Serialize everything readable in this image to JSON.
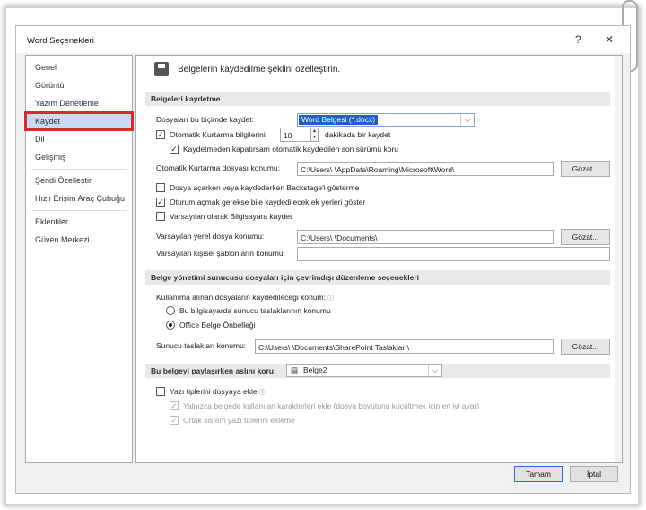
{
  "dialog": {
    "title": "Word Seçenekleri",
    "help_label": "?",
    "close_label": "✕"
  },
  "sidebar": {
    "items": [
      {
        "label": "Genel"
      },
      {
        "label": "Görüntü"
      },
      {
        "label": "Yazım Denetleme"
      },
      {
        "label": "Kaydet",
        "selected": true
      },
      {
        "label": "Dil"
      },
      {
        "label": "Gelişmiş"
      },
      {
        "label": "Şeridi Özelleştir"
      },
      {
        "label": "Hızlı Erişim Araç Çubuğu"
      },
      {
        "label": "Eklentiler"
      },
      {
        "label": "Güven Merkezi"
      }
    ]
  },
  "header": {
    "icon": "floppy-disk-icon",
    "text": "Belgelerin kaydedilme şeklini özelleştirin."
  },
  "save_docs": {
    "section_title": "Belgeleri kaydetme",
    "format_label": "Dosyaları bu biçimde kaydet:",
    "format_value": "Word Belgesi (*.docx)",
    "autorecover_label": "Otomatik Kurtarma bilgilerini",
    "autorecover_value": "10",
    "autorecover_suffix": "dakikada bir kaydet",
    "keep_last_label": "Kaydetmeden kapatırsam otomatik kaydedilen son sürümü koru",
    "autorecover_loc_label": "Otomatik Kurtarma dosyası konumu:",
    "autorecover_loc_value": "C:\\Users\\ \\AppData\\Roaming\\Microsoft\\Word\\",
    "browse_label": "Gözat...",
    "no_backstage_label": "Dosya açarken veya kaydederken Backstage'i gösterme",
    "show_more_label": "Oturum açmak gerekse bile kaydedilecek ek yerleri göster",
    "default_computer_label": "Varsayılan olarak Bilgisayara kaydet",
    "default_local_label": "Varsayılan yerel dosya konumu:",
    "default_local_value": "C:\\Users\\ \\Documents\\",
    "templates_label": "Varsayılan kişisel şablonların konumu:",
    "templates_value": ""
  },
  "offline": {
    "section_title": "Belge yönetimi sunucusu dosyaları için çevrimdışı düzenleme seçenekleri",
    "save_location_label": "Kullanıma alınan dosyaların kaydedileceği konum:",
    "radio1_label": "Bu bilgisayarda sunucu taslaklarının konumu",
    "radio2_label": "Office Belge Önbelleği",
    "drafts_label": "Sunucu taslakları konumu:",
    "drafts_value": "C:\\Users\\ \\Documents\\SharePoint Taslakları\\",
    "browse_label": "Gözat..."
  },
  "fidelity": {
    "section_title": "Bu belgeyi paylaşırken aslını koru:",
    "doc_value": "Belge2",
    "embed_fonts_label": "Yazı tiplerini dosyaya ekle",
    "embed_chars_label": "Yalnızca belgede kullanılan karakterleri ekle (dosya boyutunu küçültmek için en iyi ayar)",
    "no_common_label": "Ortak sistem yazı tiplerini ekleme"
  },
  "footer": {
    "ok_label": "Tamam",
    "cancel_label": "İptal"
  },
  "colors": {
    "selected_highlight": "#c8daf4",
    "annotation_outline": "#d62b2b",
    "dropdown_selection": "#1f5fc7"
  }
}
